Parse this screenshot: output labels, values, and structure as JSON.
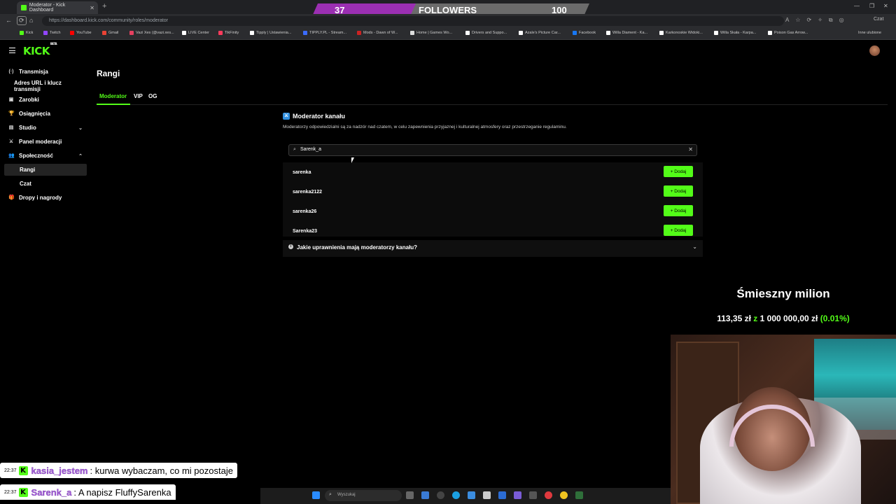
{
  "browser": {
    "tab_title": "Moderator - Kick Dashboard",
    "url": "https://dashboard.kick.com/community/roles/moderator",
    "bookmarks": [
      {
        "label": "Kick",
        "color": "#53fc18"
      },
      {
        "label": "Twitch",
        "color": "#9146ff"
      },
      {
        "label": "YouTube",
        "color": "#ff0000"
      },
      {
        "label": "Gmail",
        "color": "#ea4335"
      },
      {
        "label": "Vazi Xes (@vazi.xes...",
        "color": "#e4405f"
      },
      {
        "label": "LIVE Center",
        "color": "#ffffff"
      },
      {
        "label": "TikFinity",
        "color": "#ff3b5c"
      },
      {
        "label": "Tipply | Ustawienia...",
        "color": "#ffffff"
      },
      {
        "label": "TIPPLY.PL - Stream...",
        "color": "#3b6cff"
      },
      {
        "label": "Mods - Dawn of W...",
        "color": "#cc2222"
      },
      {
        "label": "Home | Games Wo...",
        "color": "#dddddd"
      },
      {
        "label": "Drivers and Suppo...",
        "color": "#ffffff"
      },
      {
        "label": "Azale's Picture Car...",
        "color": "#ffffff"
      },
      {
        "label": "Facebook",
        "color": "#1877f2"
      },
      {
        "label": "Willa Diament - Ka...",
        "color": "#ffffff"
      },
      {
        "label": "Karkonoskie Widoki...",
        "color": "#ffffff"
      },
      {
        "label": "Willa Skała - Karpa...",
        "color": "#ffffff"
      },
      {
        "label": "Poison Gas Arrow...",
        "color": "#ffffff"
      }
    ],
    "other_bookmarks": "Inne ulubione",
    "chat_button": "Czat"
  },
  "followers_overlay": {
    "current": "37",
    "label": "FOLLOWERS",
    "goal": "100"
  },
  "sidebar": {
    "items": [
      {
        "label": "Transmisja",
        "icon": "(·)"
      },
      {
        "label": "Adres URL i klucz transmisji",
        "icon": ""
      },
      {
        "label": "Zarobki",
        "icon": "▣"
      },
      {
        "label": "Osiągnięcia",
        "icon": "🏆"
      },
      {
        "label": "Studio",
        "icon": "▤"
      },
      {
        "label": "Panel moderacji",
        "icon": "⚔"
      },
      {
        "label": "Społeczność",
        "icon": "👥"
      },
      {
        "label": "Rangi",
        "icon": ""
      },
      {
        "label": "Czat",
        "icon": ""
      },
      {
        "label": "Dropy i nagrody",
        "icon": "🎁"
      }
    ]
  },
  "main": {
    "title": "Rangi",
    "tabs": [
      "Moderator",
      "VIP",
      "OG"
    ],
    "panel_title": "Moderator kanału",
    "panel_desc": "Moderatorzy odpowiedzialni są za nadzór nad czatem, w celu zapewnienia przyjaznej i kulturalnej atmosfery oraz przestrzeganie regulaminu.",
    "search_value": "Sarenk_a",
    "results": [
      "sarenka",
      "sarenka2122",
      "sarenka26",
      "Sarenka23"
    ],
    "add_label": "+ Dodaj",
    "faq": "Jakie uprawnienia mają moderatorzy kanału?"
  },
  "goal": {
    "title": "Śmieszny milion",
    "current": "113,35 zł",
    "connector": "z",
    "target": "1 000 000,00 zł",
    "percent": "(0.01%)"
  },
  "chat": [
    {
      "time": "22:37",
      "user": "kasia_jestem",
      "message": ": kurwa wybaczam, co mi pozostaje"
    },
    {
      "time": "22:37",
      "user": "Sarenk_a",
      "message": ": A napisz FluffySarenka"
    }
  ],
  "taskbar": {
    "search_placeholder": "Wyszukaj"
  }
}
